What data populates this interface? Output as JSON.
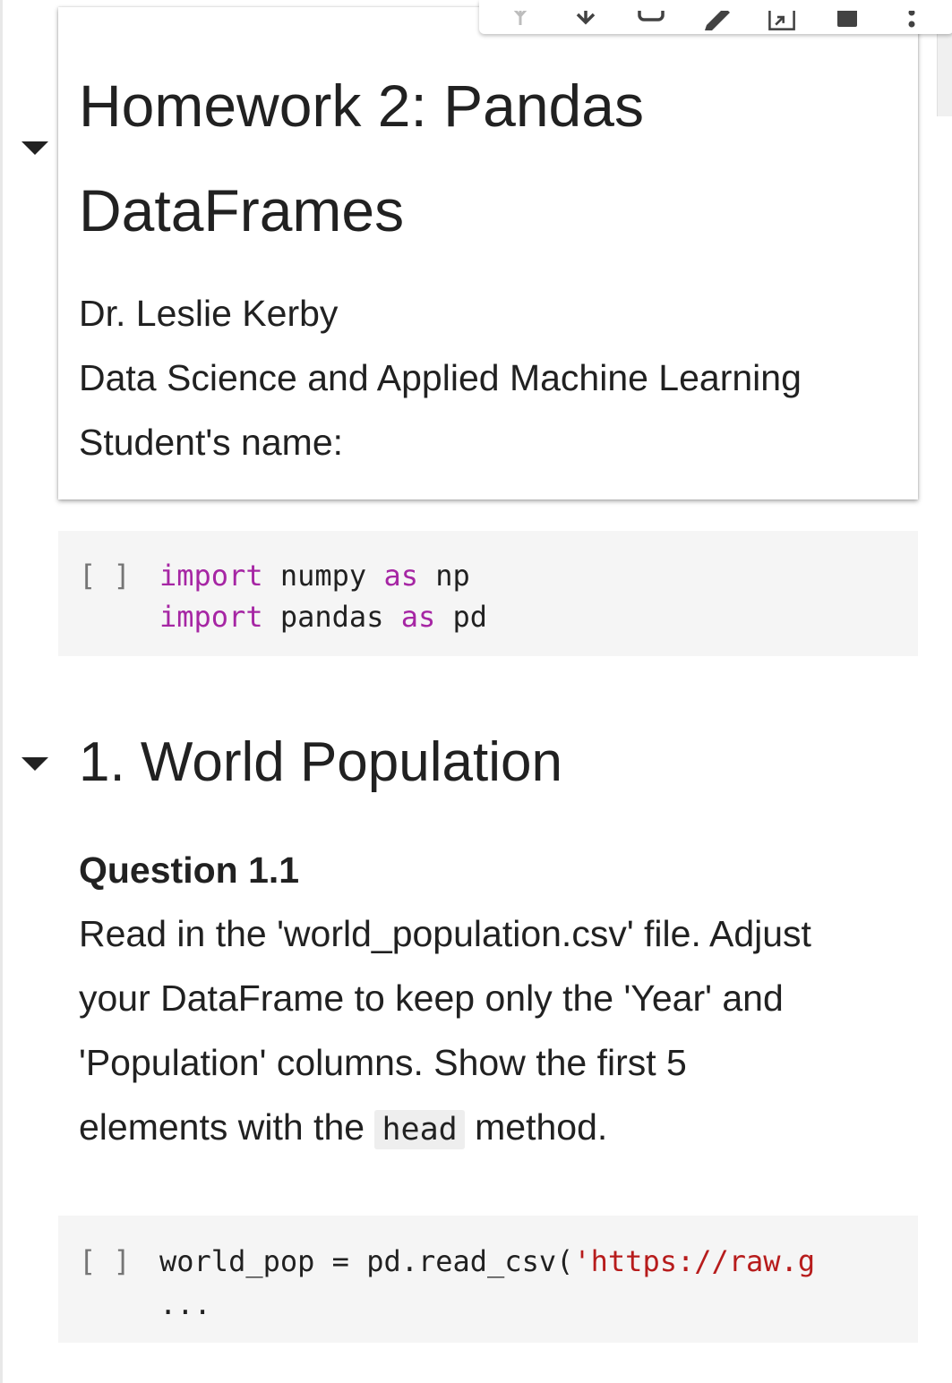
{
  "header_cell": {
    "title_line1": "Homework 2: Pandas",
    "title_line2": "DataFrames",
    "author": "Dr. Leslie Kerby",
    "course": "Data Science and Applied Machine Learning",
    "student_label": "Student's name:"
  },
  "cell_toolbar": {
    "icons": [
      "move-up-icon",
      "move-down-icon",
      "link-icon",
      "edit-icon",
      "mirror-cell-icon",
      "delete-icon",
      "more-options-icon"
    ]
  },
  "code_cell_1": {
    "run_label": "[ ]",
    "line1": {
      "kw": "import",
      "mod": " numpy ",
      "as": "as",
      "alias": " np"
    },
    "line2": {
      "kw": "import",
      "mod": " pandas ",
      "as": "as",
      "alias": " pd"
    }
  },
  "section_1": {
    "heading": "1. World Population",
    "question_title": "Question 1.1",
    "para_line1": "Read in the 'world_population.csv' file. Adjust",
    "para_line2": "your DataFrame to keep only the 'Year' and",
    "para_line3": "'Population' columns. Show the first 5",
    "para_line4_pre": "elements with the ",
    "para_line4_code": "head",
    "para_line4_post": " method."
  },
  "code_cell_2": {
    "run_label": "[ ]",
    "line1_code": "world_pop = pd.read_csv(",
    "line1_str": "'https://raw.g",
    "line2": "..."
  },
  "colors": {
    "keyword": "#a626a4",
    "string": "#b71c1c",
    "code_bg": "#f5f5f5"
  }
}
